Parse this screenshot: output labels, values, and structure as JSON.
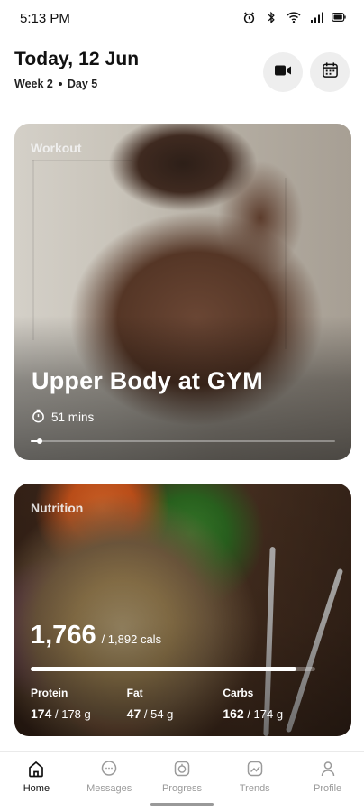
{
  "status_bar": {
    "time": "5:13 PM",
    "icons": [
      "alarm-icon",
      "bluetooth-icon",
      "wifi-icon",
      "signal-icon",
      "battery-icon"
    ]
  },
  "header": {
    "date_title": "Today, 12 Jun",
    "week": "Week 2",
    "day": "Day 5",
    "video_button_icon": "video-camera-icon",
    "calendar_button_icon": "calendar-icon"
  },
  "workout": {
    "label": "Workout",
    "title": "Upper Body at GYM",
    "duration": "51 mins",
    "progress_fraction": 0.03
  },
  "nutrition": {
    "label": "Nutrition",
    "calories_consumed": "1,766",
    "calories_target": "/ 1,892 cals",
    "calorie_fraction": 0.933,
    "macros": [
      {
        "label": "Protein",
        "value": "174",
        "target": "/ 178 g"
      },
      {
        "label": "Fat",
        "value": "47",
        "target": "/ 54 g"
      },
      {
        "label": "Carbs",
        "value": "162",
        "target": "/ 174 g"
      }
    ]
  },
  "nav": {
    "items": [
      {
        "label": "Home",
        "icon": "home-icon",
        "active": true
      },
      {
        "label": "Messages",
        "icon": "chat-icon",
        "active": false
      },
      {
        "label": "Progress",
        "icon": "progress-icon",
        "active": false
      },
      {
        "label": "Trends",
        "icon": "trends-icon",
        "active": false
      },
      {
        "label": "Profile",
        "icon": "profile-icon",
        "active": false
      }
    ]
  },
  "colors": {
    "active_nav": "#111111",
    "inactive_nav": "#9a9a9a",
    "header_button_bg": "#eeeeee"
  }
}
